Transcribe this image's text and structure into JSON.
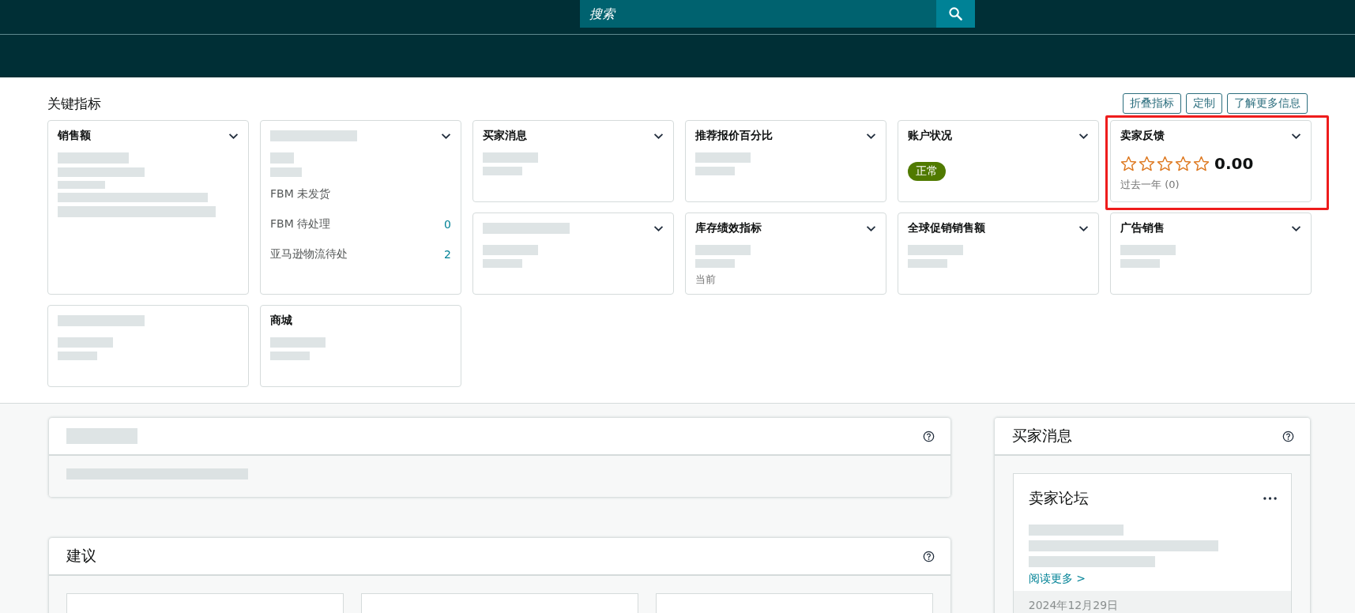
{
  "header": {
    "search": {
      "placeholder": "搜索"
    }
  },
  "key_metrics": {
    "title": "关键指标",
    "buttons": [
      "折叠指标",
      "定制",
      "了解更多信息"
    ],
    "cards": [
      {
        "kind": "tall",
        "title": "销售额",
        "has_menu": true
      },
      {
        "kind": "list",
        "has_menu": true,
        "rows": [
          {
            "label": "FBM 未发货"
          },
          {
            "label": "FBM 待处理",
            "value": "0"
          },
          {
            "label": "亚马逊物流待处",
            "value": "2"
          }
        ]
      },
      {
        "kind": "plain",
        "title": "买家消息",
        "has_menu": true
      },
      {
        "kind": "plain",
        "title": "推荐报价百分比",
        "has_menu": true
      },
      {
        "kind": "status",
        "title": "账户状况",
        "has_menu": true,
        "badge": "正常"
      },
      {
        "kind": "feedback",
        "title": "卖家反馈",
        "has_menu": true,
        "highlighted": true,
        "stars": 0,
        "score": "0.00",
        "period": "过去一年 (0)"
      },
      {
        "kind": "plain",
        "has_menu": true
      },
      {
        "kind": "plain",
        "title": "库存绩效指标",
        "has_menu": true,
        "caption": "当前"
      },
      {
        "kind": "plain",
        "title": "全球促销销售额",
        "has_menu": true
      },
      {
        "kind": "plain",
        "title": "广告销售",
        "has_menu": true
      },
      {
        "kind": "plain",
        "has_menu": false
      },
      {
        "kind": "plain",
        "title": "商城",
        "has_menu": false
      }
    ]
  },
  "panels": [
    {
      "kind": "notice"
    },
    {
      "kind": "suggestions",
      "title": "建议"
    }
  ],
  "buyer_messages": {
    "title": "买家消息",
    "forum": {
      "title": "卖家论坛",
      "posts": [
        {
          "selected": false,
          "link": "阅读更多 >"
        },
        {
          "selected": true,
          "date": "2024年12月29日"
        }
      ]
    }
  }
}
